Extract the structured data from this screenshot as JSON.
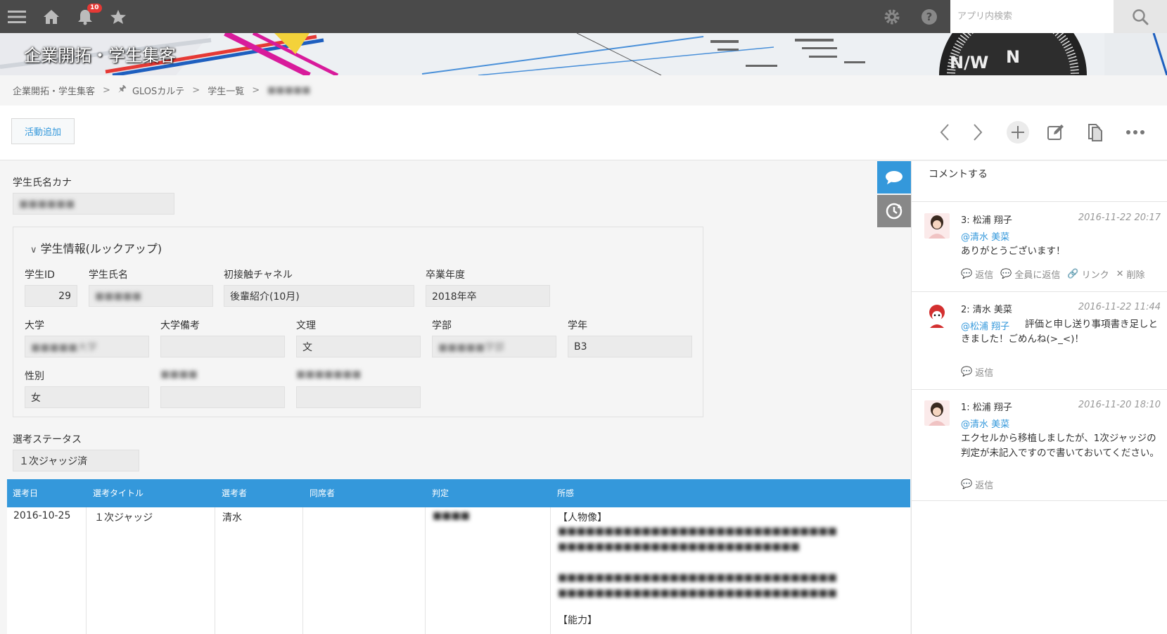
{
  "topbar": {
    "notification_count": "10",
    "search_placeholder": "アプリ内検索",
    "icons": [
      "menu-icon",
      "home-icon",
      "bell-icon",
      "star-icon",
      "gear-icon",
      "help-icon",
      "search-icon"
    ]
  },
  "banner": {
    "title": "企業開拓・学生集客"
  },
  "breadcrumb": {
    "items": [
      "企業開拓・学生集客",
      "GLOSカルテ",
      "学生一覧",
      "■■■■■"
    ],
    "separator": ">"
  },
  "toolbar": {
    "add_activity_label": "活動追加"
  },
  "record": {
    "kana_label": "学生氏名カナ",
    "kana_value": "■■■■■■",
    "group_title": "学生情報(ルックアップ)",
    "fields": {
      "student_id_label": "学生ID",
      "student_id_value": "29",
      "student_name_label": "学生氏名",
      "student_name_value": "■■■■■",
      "first_contact_label": "初接触チャネル",
      "first_contact_value": "後輩紹介(10月)",
      "graduation_label": "卒業年度",
      "graduation_value": "2018年卒",
      "university_label": "大学",
      "university_value": "■■■■■大学",
      "university_note_label": "大学備考",
      "university_note_value": "",
      "humanities_label": "文理",
      "humanities_value": "文",
      "faculty_label": "学部",
      "faculty_value": "■■■■■学部",
      "grade_label": "学年",
      "grade_value": "B3",
      "gender_label": "性別",
      "gender_value": "女",
      "hidden1_label": "■■■■",
      "hidden2_label": "■■■■■■■"
    },
    "status_label": "選考ステータス",
    "status_value": "１次ジャッジ済"
  },
  "table": {
    "headers": [
      "選考日",
      "選考タイトル",
      "選考者",
      "同席者",
      "判定",
      "所感"
    ],
    "rows": [
      {
        "date": "2016-10-25",
        "title": "１次ジャッジ",
        "selector": "清水",
        "attendee": "",
        "judgement": "■■■■",
        "impression_heading": "【人物像】",
        "impression_lines": [
          "■■■■■■■■■■■■■■■■■■■■■■■■■■■■■■",
          "■■■■■■■■■■■■■■■■■■■■■■■■■■",
          "",
          "■■■■■■■■■■■■■■■■■■■■■■■■■■■■■■",
          "■■■■■■■■■■■■■■■■■■■■■■■■■■■■■■"
        ],
        "impression_heading2": "【能力】"
      }
    ]
  },
  "comments": {
    "input_placeholder": "コメントする",
    "items": [
      {
        "author": "3: 松浦 翔子",
        "date": "2016-11-22 20:17",
        "mention": "@清水 美菜",
        "body": "ありがとうございます！",
        "actions": [
          "返信",
          "全員に返信",
          "リンク",
          "削除"
        ]
      },
      {
        "author": "2: 清水 美菜",
        "date": "2016-11-22 11:44",
        "mention": "@松浦 翔子",
        "body": "評価と申し送り事項書き足しときました！ごめんね(>_<)！",
        "actions": [
          "返信"
        ]
      },
      {
        "author": "1: 松浦 翔子",
        "date": "2016-11-20 18:10",
        "mention": "@清水 美菜",
        "body": "エクセルから移植しましたが、1次ジャッジの判定が未記入ですので書いておいてください。",
        "actions": [
          "返信"
        ]
      }
    ]
  },
  "colors": {
    "accent": "#3498db",
    "topbar": "#4a4a4a",
    "badge": "#e53935"
  }
}
